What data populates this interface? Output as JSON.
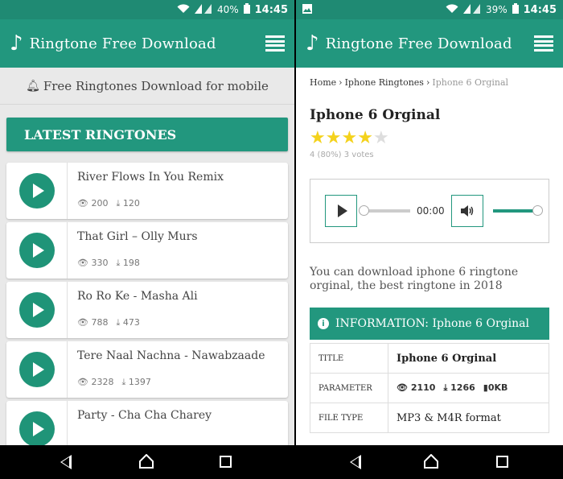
{
  "left": {
    "status": {
      "battery": "40%",
      "time": "14:45"
    },
    "app_title": "Ringtone Free Download",
    "tagline": "Free Ringtones Download for mobile",
    "latest_header": "LATEST RINGTONES",
    "ringtones": [
      {
        "name": "River Flows In You Remix",
        "views": "200",
        "downloads": "120"
      },
      {
        "name": "That Girl – Olly Murs",
        "views": "330",
        "downloads": "198"
      },
      {
        "name": "Ro Ro Ke - Masha Ali",
        "views": "788",
        "downloads": "473"
      },
      {
        "name": "Tere Naal Nachna - Nawabzaade",
        "views": "2328",
        "downloads": "1397"
      },
      {
        "name": "Party - Cha Cha Charey",
        "views": "",
        "downloads": ""
      }
    ]
  },
  "right": {
    "status": {
      "battery": "39%",
      "time": "14:45"
    },
    "app_title": "Ringtone Free Download",
    "breadcrumb": {
      "home": "Home",
      "category": "Iphone Ringtones",
      "current": "Iphone 6 Orginal",
      "sep": "›"
    },
    "title": "Iphone 6 Orginal",
    "rating": {
      "value": 4,
      "max": 5,
      "text": "4 (80%) 3 votes"
    },
    "player": {
      "time": "00:00",
      "progress": 0,
      "volume": 1
    },
    "description": "You can download iphone 6 ringtone orginal, the best ringtone in 2018",
    "info_header": "INFORMATION: Iphone 6 Orginal",
    "info_rows": {
      "title_key": "TITLE",
      "title_value": "Iphone 6 Orginal",
      "param_key": "PARAMETER",
      "param_views": "2110",
      "param_downloads": "1266",
      "param_size": "0KB",
      "type_key": "FILE TYPE",
      "type_value": "MP3 & M4R format"
    }
  },
  "colors": {
    "primary": "#22977e",
    "status_bar": "#1f8a73",
    "star": "#f4d21c"
  },
  "icons": [
    "music-note-icon",
    "menu-icon",
    "bell-icon",
    "play-icon",
    "eye-icon",
    "download-icon",
    "volume-icon",
    "info-icon",
    "file-icon",
    "wifi-icon",
    "signal-icon",
    "battery-icon",
    "image-icon",
    "back-icon",
    "home-icon",
    "recent-apps-icon"
  ]
}
